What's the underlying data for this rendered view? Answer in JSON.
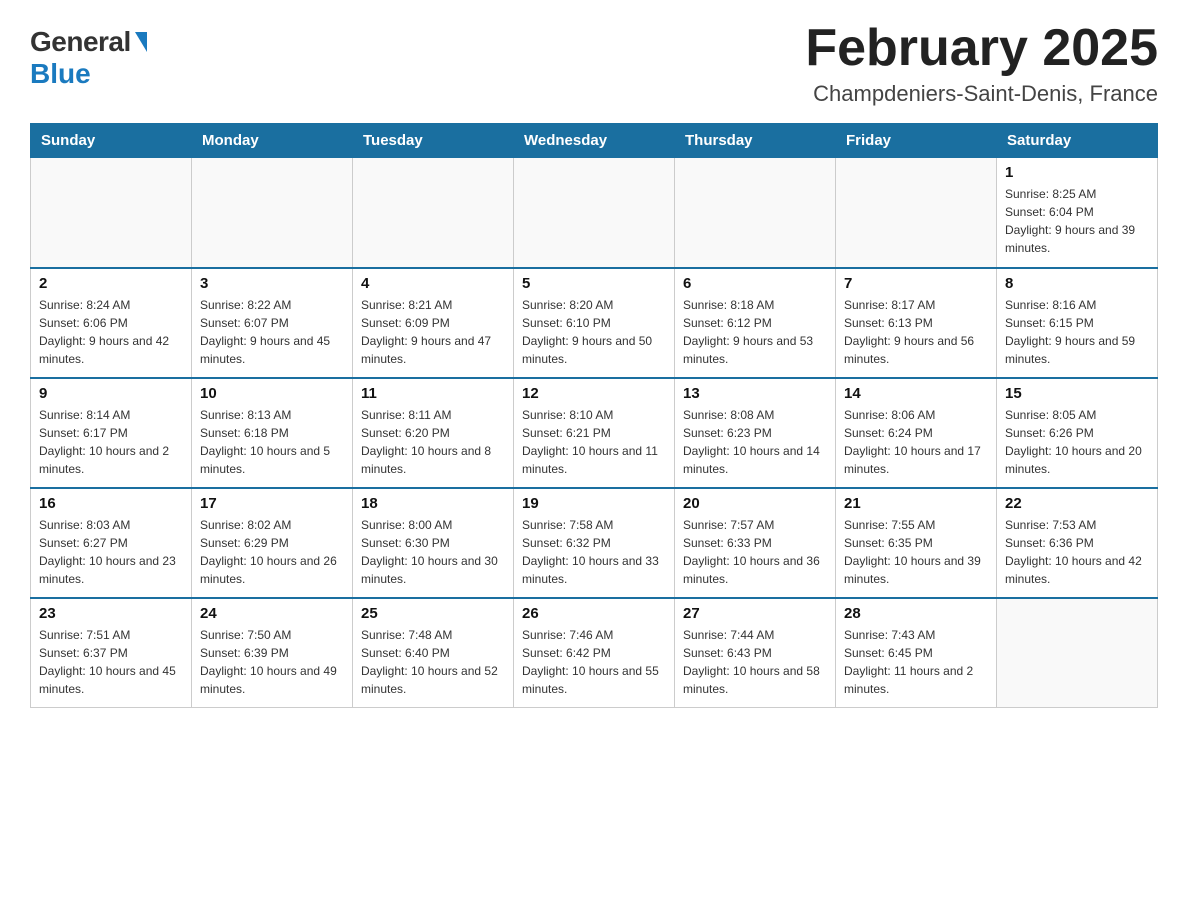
{
  "header": {
    "logo_general": "General",
    "logo_blue": "Blue",
    "month_title": "February 2025",
    "location": "Champdeniers-Saint-Denis, France"
  },
  "weekdays": [
    "Sunday",
    "Monday",
    "Tuesday",
    "Wednesday",
    "Thursday",
    "Friday",
    "Saturday"
  ],
  "weeks": [
    [
      {
        "day": "",
        "info": ""
      },
      {
        "day": "",
        "info": ""
      },
      {
        "day": "",
        "info": ""
      },
      {
        "day": "",
        "info": ""
      },
      {
        "day": "",
        "info": ""
      },
      {
        "day": "",
        "info": ""
      },
      {
        "day": "1",
        "info": "Sunrise: 8:25 AM\nSunset: 6:04 PM\nDaylight: 9 hours and 39 minutes."
      }
    ],
    [
      {
        "day": "2",
        "info": "Sunrise: 8:24 AM\nSunset: 6:06 PM\nDaylight: 9 hours and 42 minutes."
      },
      {
        "day": "3",
        "info": "Sunrise: 8:22 AM\nSunset: 6:07 PM\nDaylight: 9 hours and 45 minutes."
      },
      {
        "day": "4",
        "info": "Sunrise: 8:21 AM\nSunset: 6:09 PM\nDaylight: 9 hours and 47 minutes."
      },
      {
        "day": "5",
        "info": "Sunrise: 8:20 AM\nSunset: 6:10 PM\nDaylight: 9 hours and 50 minutes."
      },
      {
        "day": "6",
        "info": "Sunrise: 8:18 AM\nSunset: 6:12 PM\nDaylight: 9 hours and 53 minutes."
      },
      {
        "day": "7",
        "info": "Sunrise: 8:17 AM\nSunset: 6:13 PM\nDaylight: 9 hours and 56 minutes."
      },
      {
        "day": "8",
        "info": "Sunrise: 8:16 AM\nSunset: 6:15 PM\nDaylight: 9 hours and 59 minutes."
      }
    ],
    [
      {
        "day": "9",
        "info": "Sunrise: 8:14 AM\nSunset: 6:17 PM\nDaylight: 10 hours and 2 minutes."
      },
      {
        "day": "10",
        "info": "Sunrise: 8:13 AM\nSunset: 6:18 PM\nDaylight: 10 hours and 5 minutes."
      },
      {
        "day": "11",
        "info": "Sunrise: 8:11 AM\nSunset: 6:20 PM\nDaylight: 10 hours and 8 minutes."
      },
      {
        "day": "12",
        "info": "Sunrise: 8:10 AM\nSunset: 6:21 PM\nDaylight: 10 hours and 11 minutes."
      },
      {
        "day": "13",
        "info": "Sunrise: 8:08 AM\nSunset: 6:23 PM\nDaylight: 10 hours and 14 minutes."
      },
      {
        "day": "14",
        "info": "Sunrise: 8:06 AM\nSunset: 6:24 PM\nDaylight: 10 hours and 17 minutes."
      },
      {
        "day": "15",
        "info": "Sunrise: 8:05 AM\nSunset: 6:26 PM\nDaylight: 10 hours and 20 minutes."
      }
    ],
    [
      {
        "day": "16",
        "info": "Sunrise: 8:03 AM\nSunset: 6:27 PM\nDaylight: 10 hours and 23 minutes."
      },
      {
        "day": "17",
        "info": "Sunrise: 8:02 AM\nSunset: 6:29 PM\nDaylight: 10 hours and 26 minutes."
      },
      {
        "day": "18",
        "info": "Sunrise: 8:00 AM\nSunset: 6:30 PM\nDaylight: 10 hours and 30 minutes."
      },
      {
        "day": "19",
        "info": "Sunrise: 7:58 AM\nSunset: 6:32 PM\nDaylight: 10 hours and 33 minutes."
      },
      {
        "day": "20",
        "info": "Sunrise: 7:57 AM\nSunset: 6:33 PM\nDaylight: 10 hours and 36 minutes."
      },
      {
        "day": "21",
        "info": "Sunrise: 7:55 AM\nSunset: 6:35 PM\nDaylight: 10 hours and 39 minutes."
      },
      {
        "day": "22",
        "info": "Sunrise: 7:53 AM\nSunset: 6:36 PM\nDaylight: 10 hours and 42 minutes."
      }
    ],
    [
      {
        "day": "23",
        "info": "Sunrise: 7:51 AM\nSunset: 6:37 PM\nDaylight: 10 hours and 45 minutes."
      },
      {
        "day": "24",
        "info": "Sunrise: 7:50 AM\nSunset: 6:39 PM\nDaylight: 10 hours and 49 minutes."
      },
      {
        "day": "25",
        "info": "Sunrise: 7:48 AM\nSunset: 6:40 PM\nDaylight: 10 hours and 52 minutes."
      },
      {
        "day": "26",
        "info": "Sunrise: 7:46 AM\nSunset: 6:42 PM\nDaylight: 10 hours and 55 minutes."
      },
      {
        "day": "27",
        "info": "Sunrise: 7:44 AM\nSunset: 6:43 PM\nDaylight: 10 hours and 58 minutes."
      },
      {
        "day": "28",
        "info": "Sunrise: 7:43 AM\nSunset: 6:45 PM\nDaylight: 11 hours and 2 minutes."
      },
      {
        "day": "",
        "info": ""
      }
    ]
  ]
}
